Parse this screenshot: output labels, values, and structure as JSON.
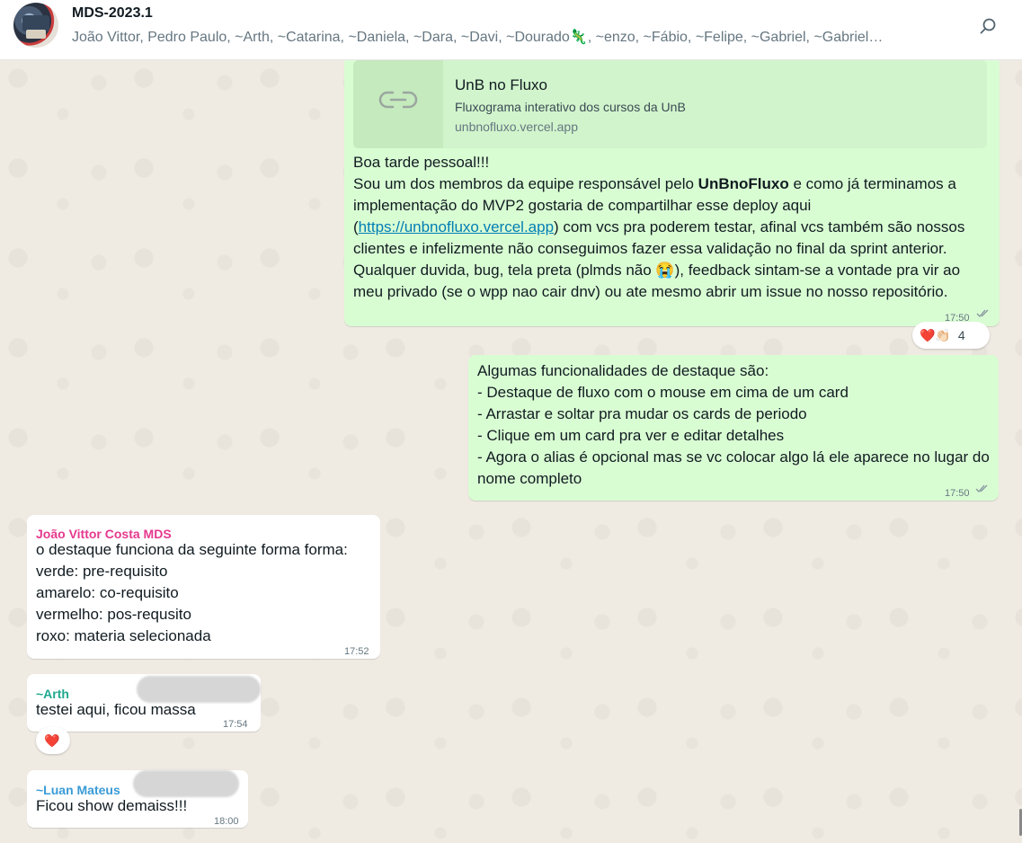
{
  "header": {
    "title": "MDS-2023.1",
    "participants": "João Vittor, Pedro Paulo, ~Arth, ~Catarina, ~Daniela, ~Dara, ~Davi, ~Dourado🦎, ~enzo, ~Fábio, ~Felipe, ~Gabriel, ~Gabriel…",
    "search_icon": "search-icon"
  },
  "messages": [
    {
      "direction": "outgoing",
      "link_preview": {
        "title": "UnB no Fluxo",
        "description": "Fluxograma interativo dos cursos da UnB",
        "url": "unbnofluxo.vercel.app",
        "icon": "link-icon"
      },
      "text_line1": "Boa tarde pessoal!!!",
      "text_part1": "Sou um dos membros da equipe responsável pelo ",
      "text_bold": "UnBnoFluxo",
      "text_part2": " e como já terminamos a implementação do MVP2 gostaria de compartilhar esse deploy aqui (",
      "link_text": "https://unbnofluxo.vercel.app",
      "text_part3": ") com vcs pra poderem testar, afinal vcs também são nossos clientes e infelizmente não conseguimos fazer essa validação no final da sprint anterior. Qualquer duvida, bug, tela preta (plmds não 😭), feedback sintam-se a vontade pra vir ao meu privado (se o wpp nao cair dnv) ou ate mesmo abrir um issue no nosso repositório.",
      "time": "17:50",
      "reactions": {
        "emojis": "❤️👏🏻",
        "count": "4"
      }
    },
    {
      "direction": "outgoing",
      "text": "Algumas funcionalidades de destaque são:\n- Destaque de fluxo com o mouse em cima de um card\n- Arrastar e soltar pra mudar os cards de periodo\n- Clique em um card pra ver e editar detalhes\n- Agora o alias é opcional mas se vc colocar algo lá ele aparece no lugar do nome completo",
      "time": "17:50"
    },
    {
      "direction": "incoming",
      "sender": "João Vittor Costa MDS",
      "sender_color": "#e5398e",
      "text": "o destaque funciona da seguinte forma forma:\nverde: pre-requisito\namarelo: co-requisito\nvermelho: pos-requsito\nroxo: materia selecionada",
      "time": "17:52"
    },
    {
      "direction": "incoming",
      "sender": "~Arth",
      "sender_color": "#1fa890",
      "text": "testei aqui, ficou massa",
      "time": "17:54",
      "reaction": "❤️"
    },
    {
      "direction": "incoming",
      "sender": "~Luan Mateus",
      "sender_color": "#3a9bd6",
      "text": "Ficou show demaiss!!!",
      "time": "18:00"
    }
  ],
  "colors": {
    "outgoing_bubble": "#d9fdd3",
    "incoming_bubble": "#ffffff",
    "chat_background": "#efeae2",
    "link": "#027eb5"
  }
}
